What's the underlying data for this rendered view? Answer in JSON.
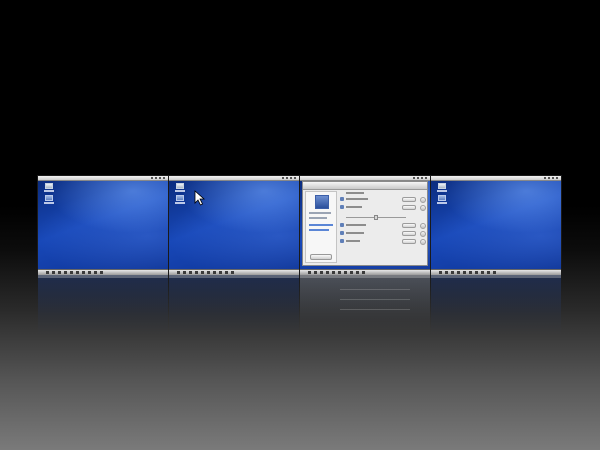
{
  "screen": {
    "type": "workspace-overview",
    "workspace_count": 4,
    "active_workspace": 3
  },
  "workspaces": [
    {
      "index": 1,
      "content": "desktop"
    },
    {
      "index": 2,
      "content": "desktop-with-cursor"
    },
    {
      "index": 3,
      "content": "preferences-dialog"
    },
    {
      "index": 4,
      "content": "desktop"
    }
  ],
  "desktop_icons": [
    "hard-drive-icon",
    "folder-icon"
  ],
  "colors": {
    "background_top": "#000000",
    "background_bottom": "#7a7a7a",
    "wallpaper_blue": "#1848b8",
    "dialog_gray": "#ececec"
  }
}
